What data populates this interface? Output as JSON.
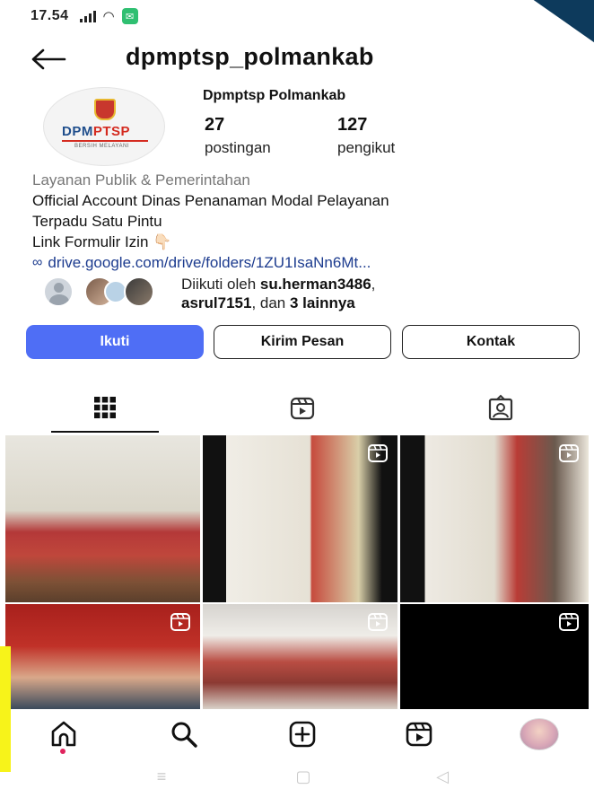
{
  "status_bar": {
    "time": "17.54",
    "signal_icon": "signal-icon",
    "wifi_icon": "wifi-icon",
    "notification_icon": "app-notification-icon"
  },
  "header": {
    "username": "dpmptsp_polmankab",
    "back_icon": "arrow-left-icon"
  },
  "profile": {
    "avatar_logo": "DPMPTSP",
    "avatar_logo_part1": "DPM",
    "avatar_logo_part2": "PTSP",
    "avatar_tagline": "BERSIH MELAYANI",
    "display_name": "Dpmptsp Polmankab",
    "stats": [
      {
        "value": "27",
        "label": "postingan"
      },
      {
        "value": "127",
        "label": "pengikut"
      }
    ],
    "category": "Layanan Publik & Pemerintahan",
    "bio_lines": [
      "Official Account Dinas Penanaman Modal Pelayanan",
      "Terpadu Satu Pintu",
      "Link Formulir Izin 👇🏻"
    ],
    "link": "drive.google.com/drive/folders/1ZU1IsaNn6Mt...",
    "followed_by": {
      "prefix": "Diikuti oleh ",
      "user1": "su.herman3486",
      "separator": ",",
      "user2": "asrul7151",
      "middle": ", dan ",
      "count": "3 lainnya"
    }
  },
  "actions": {
    "follow": "Ikuti",
    "message": "Kirim Pesan",
    "contact": "Kontak"
  },
  "tabs": [
    {
      "icon": "grid-icon",
      "active": true
    },
    {
      "icon": "reels-icon",
      "active": false
    },
    {
      "icon": "tagged-icon",
      "active": false
    }
  ],
  "posts": [
    {
      "type": "photo"
    },
    {
      "type": "reel"
    },
    {
      "type": "reel"
    },
    {
      "type": "reel"
    },
    {
      "type": "reel"
    },
    {
      "type": "reel"
    }
  ],
  "bottom_nav": [
    {
      "icon": "home-icon"
    },
    {
      "icon": "search-icon"
    },
    {
      "icon": "create-icon"
    },
    {
      "icon": "reels-icon"
    },
    {
      "icon": "profile-avatar"
    }
  ],
  "colors": {
    "primary_button": "#4f6ef5",
    "link": "#1d3c8f",
    "brand_blue": "#1f4e8c",
    "brand_red": "#d42b20",
    "notification_dot": "#e0245e"
  }
}
